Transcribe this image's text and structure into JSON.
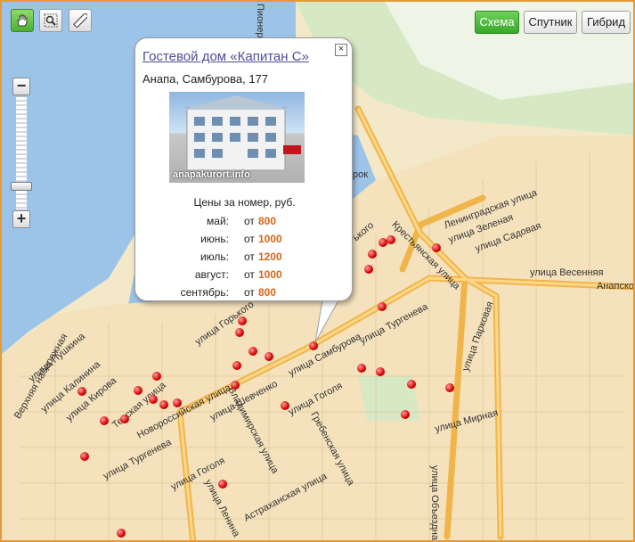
{
  "toolbar": {
    "tools": [
      {
        "name": "drag-tool",
        "icon": "hand-icon"
      },
      {
        "name": "zoom-area-tool",
        "icon": "magnifier-icon"
      },
      {
        "name": "ruler-tool",
        "icon": "ruler-icon"
      }
    ],
    "map_types": {
      "scheme": "Схема",
      "satellite": "Спутник",
      "hybrid": "Гибрид",
      "active": "scheme"
    }
  },
  "zoom": {
    "plus": "+",
    "minus": "−",
    "level_fraction": 0.7
  },
  "balloon": {
    "title": "Гостевой дом «Капитан С»",
    "address": "Анапа, Самбурова, 177",
    "photo_caption": "anapakurort.info",
    "prices_label": "Цены за номер, руб.",
    "from_label": "от",
    "prices": [
      {
        "month": "май:",
        "value": "800"
      },
      {
        "month": "июнь:",
        "value": "1000"
      },
      {
        "month": "июль:",
        "value": "1200"
      },
      {
        "month": "август:",
        "value": "1000"
      },
      {
        "month": "сентябрь:",
        "value": "800"
      }
    ],
    "close": "×"
  },
  "streets": [
    "Пионерская",
    "Ленинградская улица",
    "улица Зеленая",
    "улица Садовая",
    "улица Весенняя",
    "Анапское",
    "Крестьянская улица",
    "улица Горького",
    "улица Самбурова",
    "улица Тургенева",
    "улица Парковая",
    "улица Гоголя",
    "Гребенская улица",
    "улица Мирная",
    "улица Пушкина",
    "улица Калинина",
    "улица Кирова",
    "Терская улица",
    "Новороссийская улица",
    "улица Шевченко",
    "Владимирская улица",
    "Астраханская улица",
    "улица Ленина",
    "улица Тургенева",
    "улица Гоголя",
    "Верхняя набережная",
    "улица Объездная",
    "рок",
    "ького"
  ],
  "colors": {
    "water": "#9cc4e8",
    "land": "#f3e9c8",
    "road": "#f7c064",
    "active_green": "#39a92b",
    "marker": "#d60000",
    "link": "#4d4d9a",
    "price": "#d4661a"
  }
}
